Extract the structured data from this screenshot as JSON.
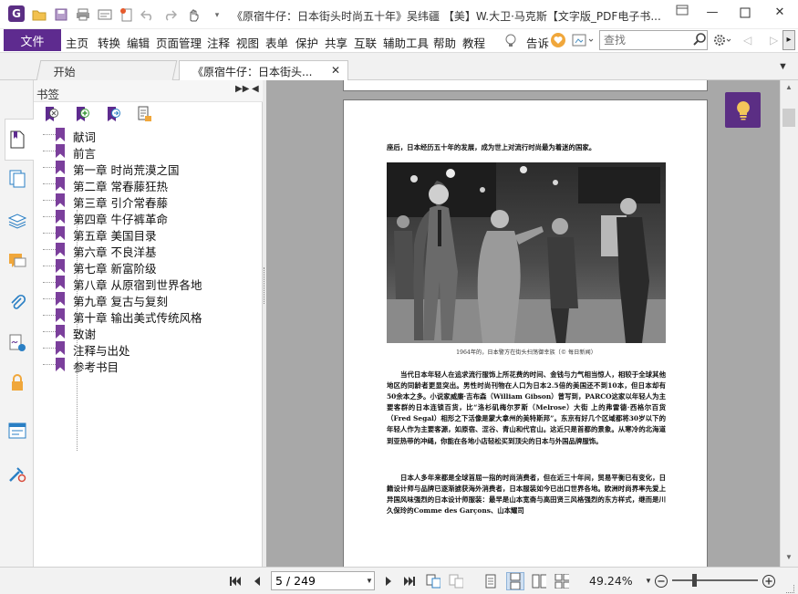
{
  "window": {
    "title": "《原宿牛仔：日本街头时尚五十年》吴纬疆 【美】W.大卫·马克斯【文字版_PDF电子书...",
    "controls": [
      "minimize",
      "maximize",
      "close"
    ]
  },
  "menu": {
    "file": "文件",
    "items": [
      "主页",
      "转换",
      "编辑",
      "页面管理",
      "注释",
      "视图",
      "表单",
      "保护",
      "共享",
      "互联",
      "辅助工具",
      "帮助",
      "教程"
    ],
    "tell_me": "告诉",
    "search_placeholder": "查找"
  },
  "tabs": [
    {
      "label": "开始",
      "active": false
    },
    {
      "label": "《原宿牛仔：日本街头...",
      "active": true
    }
  ],
  "sidebar": {
    "title": "书签",
    "bookmarks": [
      {
        "label": "献词"
      },
      {
        "label": "前言"
      },
      {
        "label": "第一章 时尚荒漠之国"
      },
      {
        "label": "第二章 常春藤狂热"
      },
      {
        "label": "第三章 引介常春藤"
      },
      {
        "label": "第四章 牛仔裤革命"
      },
      {
        "label": "第五章 美国目录"
      },
      {
        "label": "第六章 不良洋基"
      },
      {
        "label": "第七章 新富阶级"
      },
      {
        "label": "第八章 从原宿到世界各地"
      },
      {
        "label": "第九章 复古与复刻"
      },
      {
        "label": "第十章 输出美式传统风格"
      },
      {
        "label": "致谢"
      },
      {
        "label": "注释与出处"
      },
      {
        "label": "参考书目"
      }
    ]
  },
  "page": {
    "lead": "座后，日本经历五十年的发展，成为世上对流行时尚最为着迷的国家。",
    "caption": "1964年的，日本警方在街头扫荡御幸族（© 每日新闻）",
    "para1": "当代日本年轻人在追求流行服饰上所花费的时间、金钱与力气相当惊人，相较于全球其他地区的同龄者更显突出。男性时尚刊物在人口为日本2.5倍的美国还不到10本，但日本却有50余本之多。小说家威廉·吉布森（William Gibson）曾写到，PARCO这家以年轻人为主要客群的日本连锁百货，比“洛杉矶梅尔罗斯（Melrose）大街 上的弗雷德·西格尔百货（Fred Segal）相形之下活像是蒙大拿州的美特斯邦”。东京有好几个区域都将30岁以下的年轻人作为主要客源，如原宿、涩谷、青山和代官山。这近只是首都的景象。从寒冷的北海道到亚热带的冲绳，你能在各地小店轻松买到顶尖的日本与外国品牌服饰。",
    "para2": "日本人多年来都是全球首屈一指的时尚消费者，但在近三十年间，贸易平衡已有变化，日籍设计师与品牌已逐渐掳获海外消费者，日本服装如今已出口世界各地。欧洲时尚界率先爱上异国风味强烈的日本设计师服装：最早是山本宽斋与高田贤三风格强烈的东方样式，继而是川久保玲的Comme des Garçons、山本耀司"
  },
  "status": {
    "page_indicator": "5 / 249",
    "zoom": "49.24%"
  },
  "colors": {
    "brand": "#5e2b8f",
    "bookmark_flag": "#7b3f9c",
    "hint_button": "#5b2e84"
  }
}
